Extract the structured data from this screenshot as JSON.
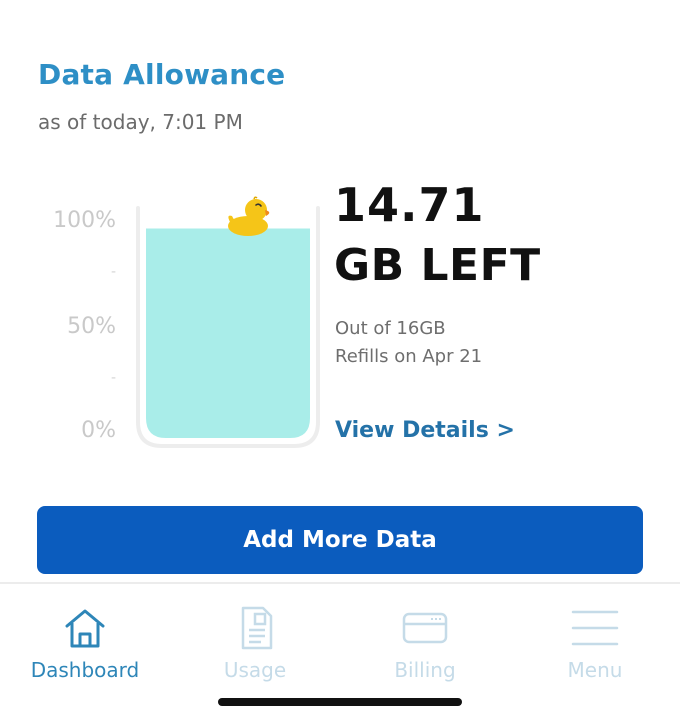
{
  "header": {
    "title": "Data Allowance",
    "subtitle": "as of today, 7:01 PM"
  },
  "gauge": {
    "scale_labels": [
      "100%",
      "50%",
      "0%"
    ],
    "tick_mark": "-",
    "fill_fraction": 0.919,
    "fill_color": "#a9ede9",
    "glass_color": "#ededed",
    "mascot": "rubber-duck-icon"
  },
  "allowance": {
    "amount": "14.71",
    "unit_label": "GB LEFT",
    "out_of": "Out of 16GB",
    "refills": "Refills on Apr 21",
    "details_link": "View Details >"
  },
  "actions": {
    "add_data_label": "Add More Data"
  },
  "nav": {
    "items": [
      {
        "label": "Dashboard",
        "icon": "home-icon",
        "active": true
      },
      {
        "label": "Usage",
        "icon": "document-icon",
        "active": false
      },
      {
        "label": "Billing",
        "icon": "credit-card-icon",
        "active": false
      },
      {
        "label": "Menu",
        "icon": "hamburger-menu-icon",
        "active": false
      }
    ]
  },
  "colors": {
    "accent": "#2e8fc6",
    "button": "#0b5cbe",
    "link": "#2472a8",
    "nav_active": "#2e86b8",
    "nav_inactive": "#c5dbe8"
  }
}
